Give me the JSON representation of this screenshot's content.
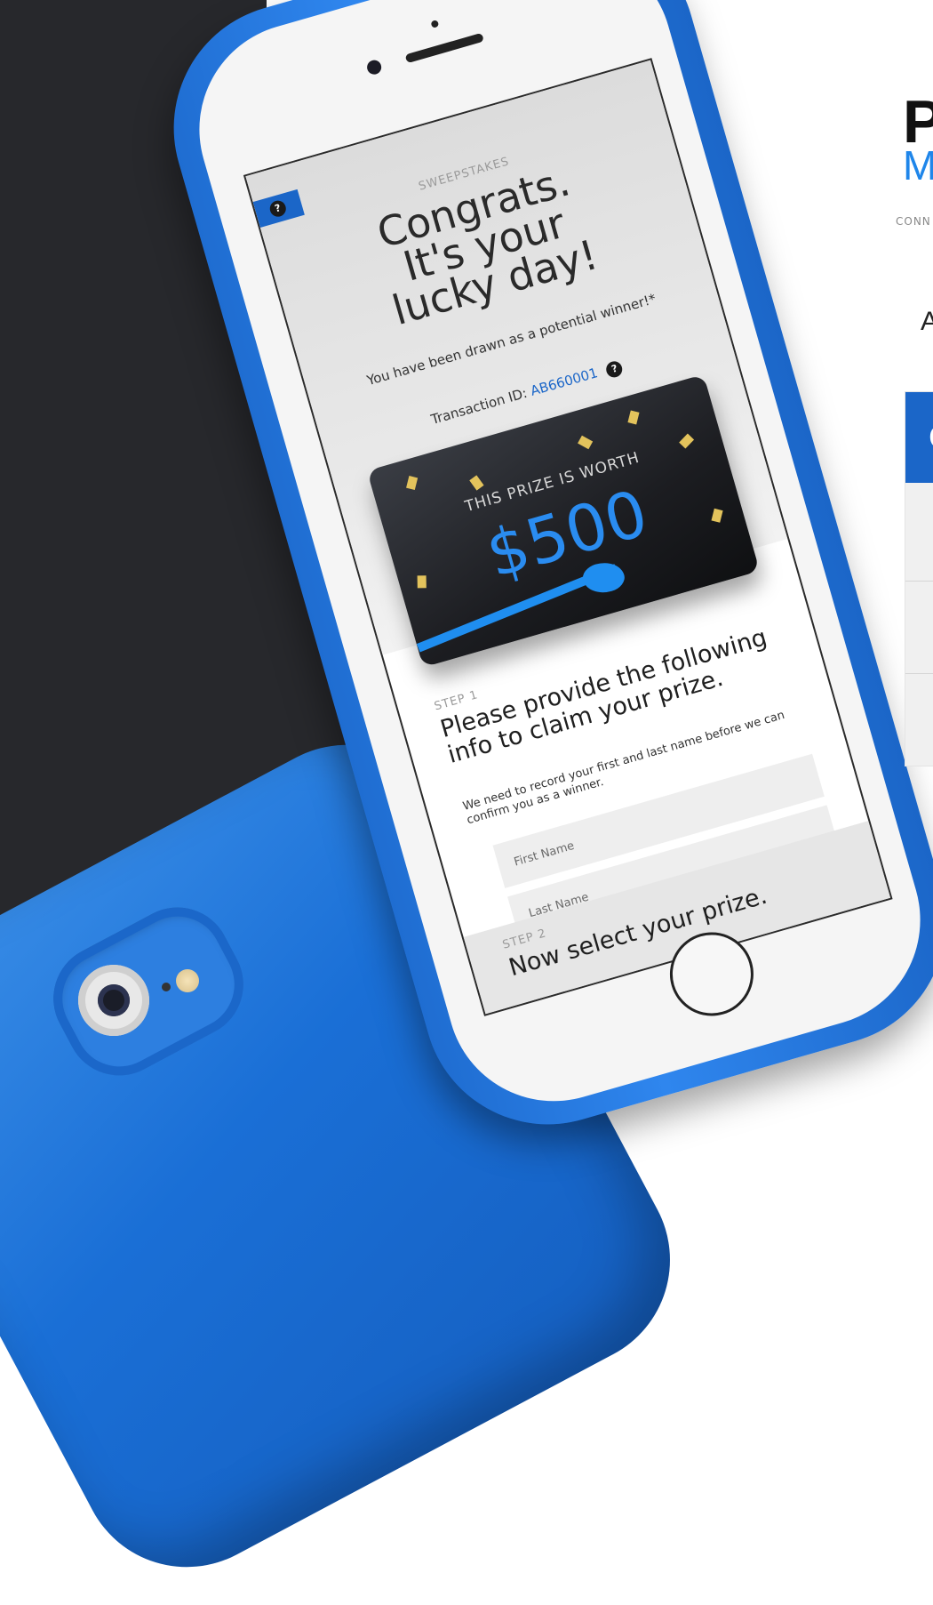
{
  "screen": {
    "eyebrow": "SWEEPSTAKES",
    "headline_lines": [
      "Congrats.",
      "It's your",
      "lucky day!"
    ],
    "drawn_text": "You have been drawn as a potential winner!*",
    "transaction_label": "Transaction ID:",
    "transaction_id": "AB660001",
    "help_glyph": "?",
    "prize_label": "THIS PRIZE IS WORTH",
    "prize_amount": "$500",
    "step1": {
      "eyebrow": "STEP 1",
      "title": "Please provide the following info to claim your prize.",
      "description": "We need to record your first and last name before we can confirm you as a winner."
    },
    "fields": {
      "first_name_placeholder": "First Name",
      "last_name_placeholder": "Last Name"
    },
    "step2": {
      "eyebrow": "STEP 2",
      "title": "Now select your prize."
    }
  },
  "side_panel": {
    "logo_letter_1": "P",
    "logo_letter_2": "M",
    "logo_sub": "CONN",
    "heading_fragment": "A",
    "table_head_fragment": "C"
  },
  "colors": {
    "accent": "#1b66c8",
    "prize_blue": "#2a8cf0",
    "phone_blue": "#2f86ee",
    "backdrop": "#27282c"
  },
  "icons": [
    "help-icon",
    "question-icon",
    "camera-icon",
    "home-button-icon"
  ]
}
